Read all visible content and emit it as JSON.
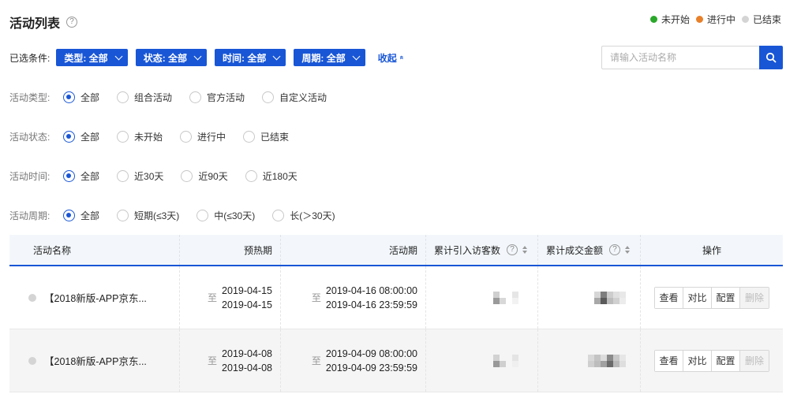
{
  "header": {
    "title": "活动列表",
    "help_glyph": "?",
    "legend": [
      {
        "label": "未开始",
        "color": "#2aa82a"
      },
      {
        "label": "进行中",
        "color": "#e8802a"
      },
      {
        "label": "已结束",
        "color": "#d4d4d4"
      }
    ]
  },
  "filters": {
    "label": "已选条件:",
    "chips": [
      "类型: 全部",
      "状态: 全部",
      "时间: 全部",
      "周期: 全部"
    ],
    "collapse": "收起",
    "collapse_icon": "«",
    "search_placeholder": "请输入活动名称"
  },
  "groups": [
    {
      "label": "活动类型:",
      "options": [
        "全部",
        "组合活动",
        "官方活动",
        "自定义活动"
      ],
      "selected": 0
    },
    {
      "label": "活动状态:",
      "options": [
        "全部",
        "未开始",
        "进行中",
        "已结束"
      ],
      "selected": 0
    },
    {
      "label": "活动时间:",
      "options": [
        "全部",
        "近30天",
        "近90天",
        "近180天"
      ],
      "selected": 0
    },
    {
      "label": "活动周期:",
      "options": [
        "全部",
        "短期(≤3天)",
        "中(≤30天)",
        "长(＞30天)"
      ],
      "selected": 0
    }
  ],
  "table": {
    "columns": [
      "活动名称",
      "预热期",
      "活动期",
      "累计引入访客数",
      "累计成交金额",
      "操作"
    ],
    "range_prefix": "至",
    "rows": [
      {
        "name": "【2018新版-APP京东...",
        "status_color": "#d4d4d4",
        "preheat": [
          "2019-04-15",
          "2019-04-15"
        ],
        "period": [
          "2019-04-16 08:00:00",
          "2019-04-16 23:59:59"
        ],
        "actions": [
          "查看",
          "对比",
          "配置",
          "删除"
        ]
      },
      {
        "name": "【2018新版-APP京东...",
        "status_color": "#d4d4d4",
        "preheat": [
          "2019-04-08",
          "2019-04-08"
        ],
        "period": [
          "2019-04-09 08:00:00",
          "2019-04-09 23:59:59"
        ],
        "actions": [
          "查看",
          "对比",
          "配置",
          "删除"
        ]
      }
    ]
  }
}
